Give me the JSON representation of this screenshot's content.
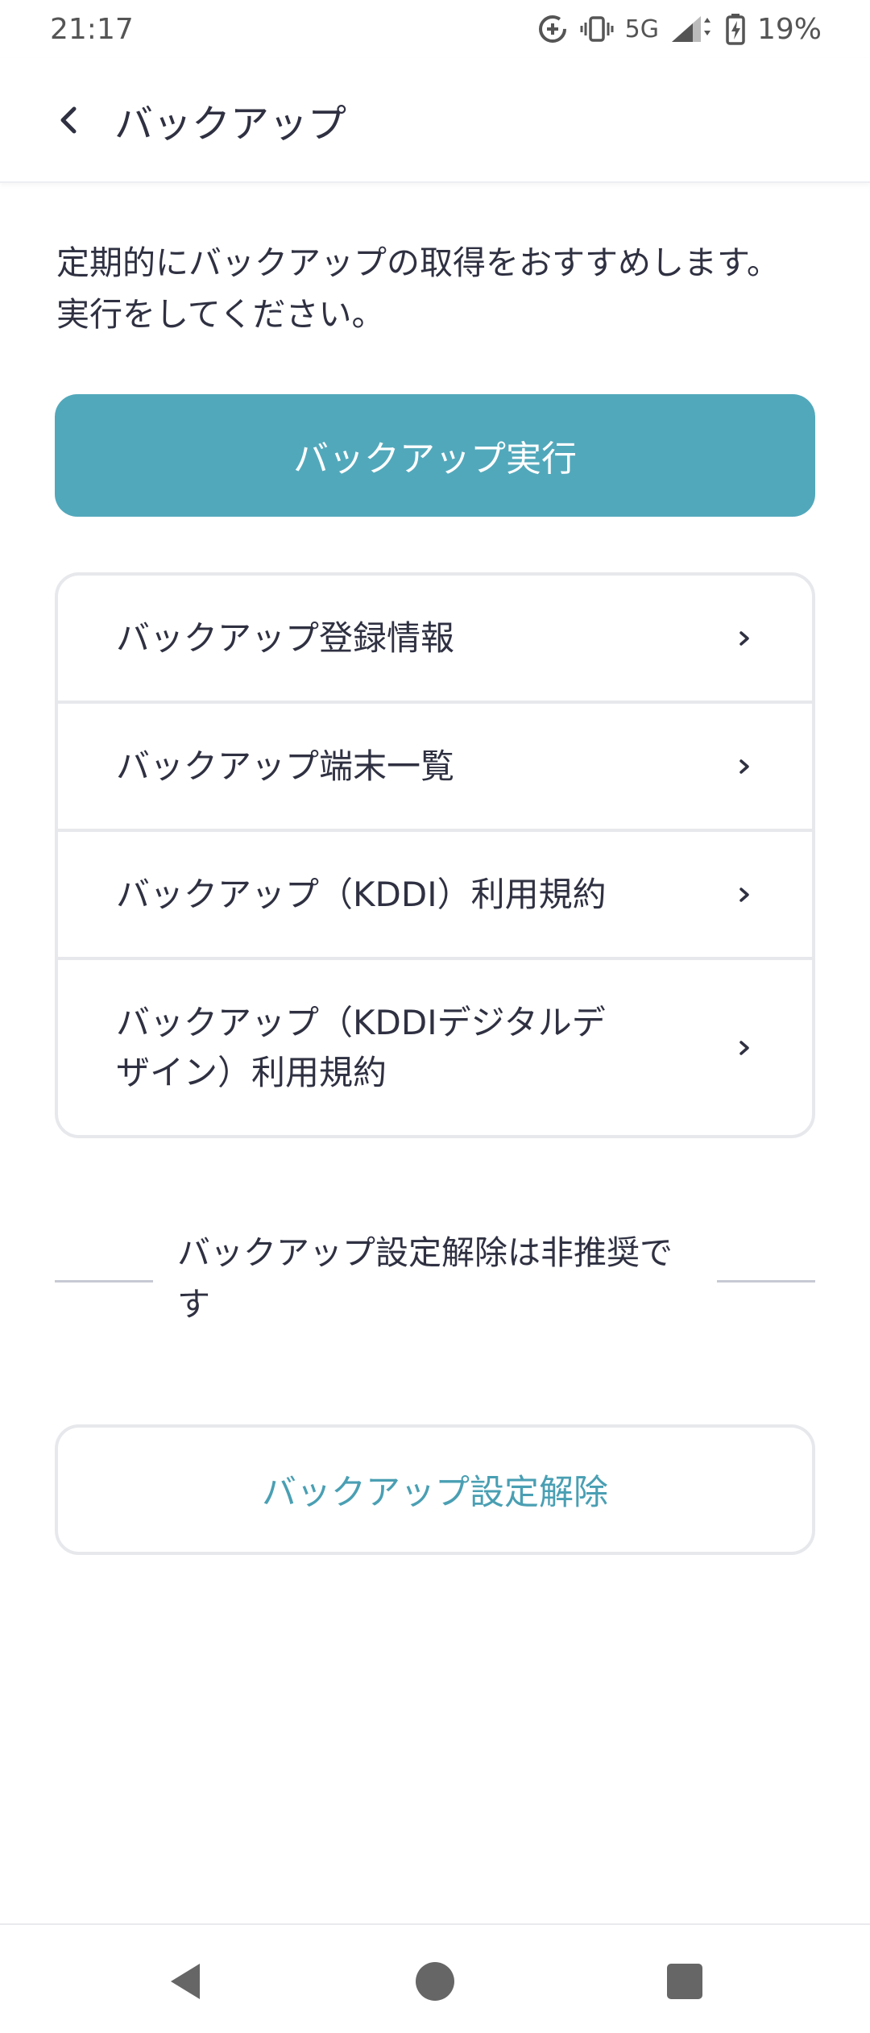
{
  "status_bar": {
    "time": "21:17",
    "network": "5G",
    "battery": "19%",
    "icons": [
      "data-saver-icon",
      "vibrate-icon",
      "signal-icon",
      "battery-charging-icon"
    ]
  },
  "app_bar": {
    "back_icon": "chevron-left-icon",
    "title": "バックアップ"
  },
  "intro": {
    "text": "定期的にバックアップの取得をおすすめします。実行をしてください。"
  },
  "primary_action": {
    "label": "バックアップ実行",
    "color": "#52a8bb"
  },
  "menu": {
    "items": [
      {
        "label": "バックアップ登録情報"
      },
      {
        "label": "バックアップ端末一覧"
      },
      {
        "label": "バックアップ（KDDI）利用規約"
      },
      {
        "label": "バックアップ（KDDIデジタルデザイン）利用規約"
      }
    ],
    "chevron_icon": "chevron-right-icon"
  },
  "warning": {
    "text": "バックアップ設定解除は非推奨です"
  },
  "secondary_action": {
    "label": "バックアップ設定解除",
    "color": "#4a9fb3"
  },
  "nav_bar": {
    "icons": [
      "nav-back-icon",
      "nav-home-icon",
      "nav-recents-icon"
    ]
  }
}
